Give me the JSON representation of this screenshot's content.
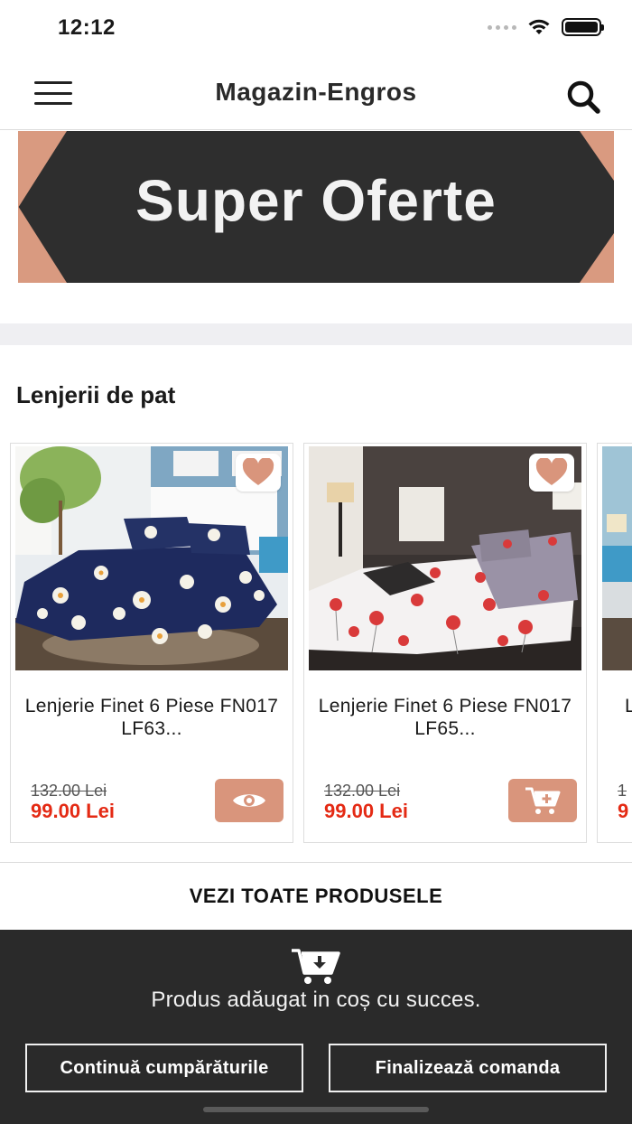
{
  "status_bar": {
    "time": "12:12"
  },
  "header": {
    "title": "Magazin-Engros",
    "menu_icon": "hamburger-menu-icon",
    "search_icon": "search-icon"
  },
  "banner": {
    "text": "Super Oferte",
    "background_color": "#2e2e2e",
    "accent_color": "#d99a80"
  },
  "section": {
    "title": "Lenjerii de pat"
  },
  "products": [
    {
      "name": "Lenjerie Finet 6 Piese FN017  LF63...",
      "old_price": "132.00 Lei",
      "new_price": "99.00 Lei",
      "action_icon": "eye-icon",
      "favorite_icon": "heart-icon"
    },
    {
      "name": "Lenjerie Finet 6 Piese FN017  LF65...",
      "old_price": "132.00 Lei",
      "new_price": "99.00 Lei",
      "action_icon": "cart-add-icon",
      "favorite_icon": "heart-icon"
    },
    {
      "name": "L",
      "old_price": "1",
      "new_price": "9",
      "action_icon": "cart-add-icon",
      "favorite_icon": "heart-icon"
    }
  ],
  "see_all": {
    "label": "VEZI TOATE PRODUSELE"
  },
  "toast": {
    "icon": "cart-download-icon",
    "message": "Produs adăugat in coș cu succes.",
    "continue_label": "Continuă cumpărăturile",
    "finalize_label": "Finalizează comanda"
  },
  "colors": {
    "accent": "#d9957c",
    "sale_price": "#e42a14",
    "toast_bg": "#2a2a2a"
  }
}
